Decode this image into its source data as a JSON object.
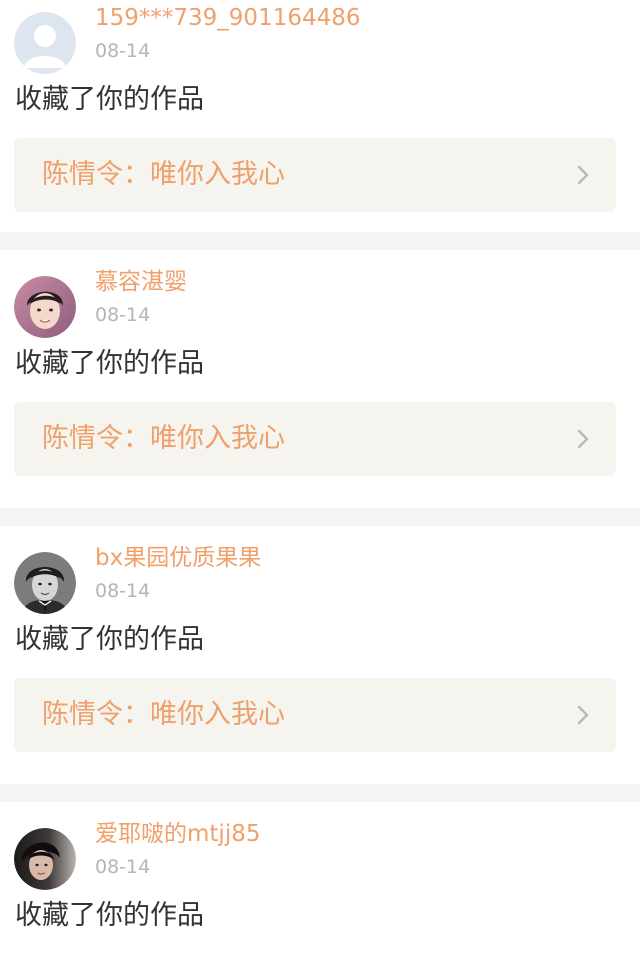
{
  "notifications": [
    {
      "username": "159***739_901164486",
      "date": "08-14",
      "action": "收藏了你的作品",
      "work_title": "陈情令：唯你入我心",
      "avatar_icon": "default-user-icon"
    },
    {
      "username": "慕容湛婴",
      "date": "08-14",
      "action": "收藏了你的作品",
      "work_title": "陈情令：唯你入我心",
      "avatar_icon": "user-photo"
    },
    {
      "username": "bx果园优质果果",
      "date": "08-14",
      "action": "收藏了你的作品",
      "work_title": "陈情令：唯你入我心",
      "avatar_icon": "user-photo"
    },
    {
      "username": "爱耶啵的mtjj85",
      "date": "08-14",
      "action": "收藏了你的作品",
      "avatar_icon": "user-photo"
    }
  ],
  "colors": {
    "accent": "#f0a06a",
    "date": "#b4b4b4",
    "text": "#333333",
    "link_bg": "#f5f4ee",
    "separator": "#f4f4f4"
  }
}
